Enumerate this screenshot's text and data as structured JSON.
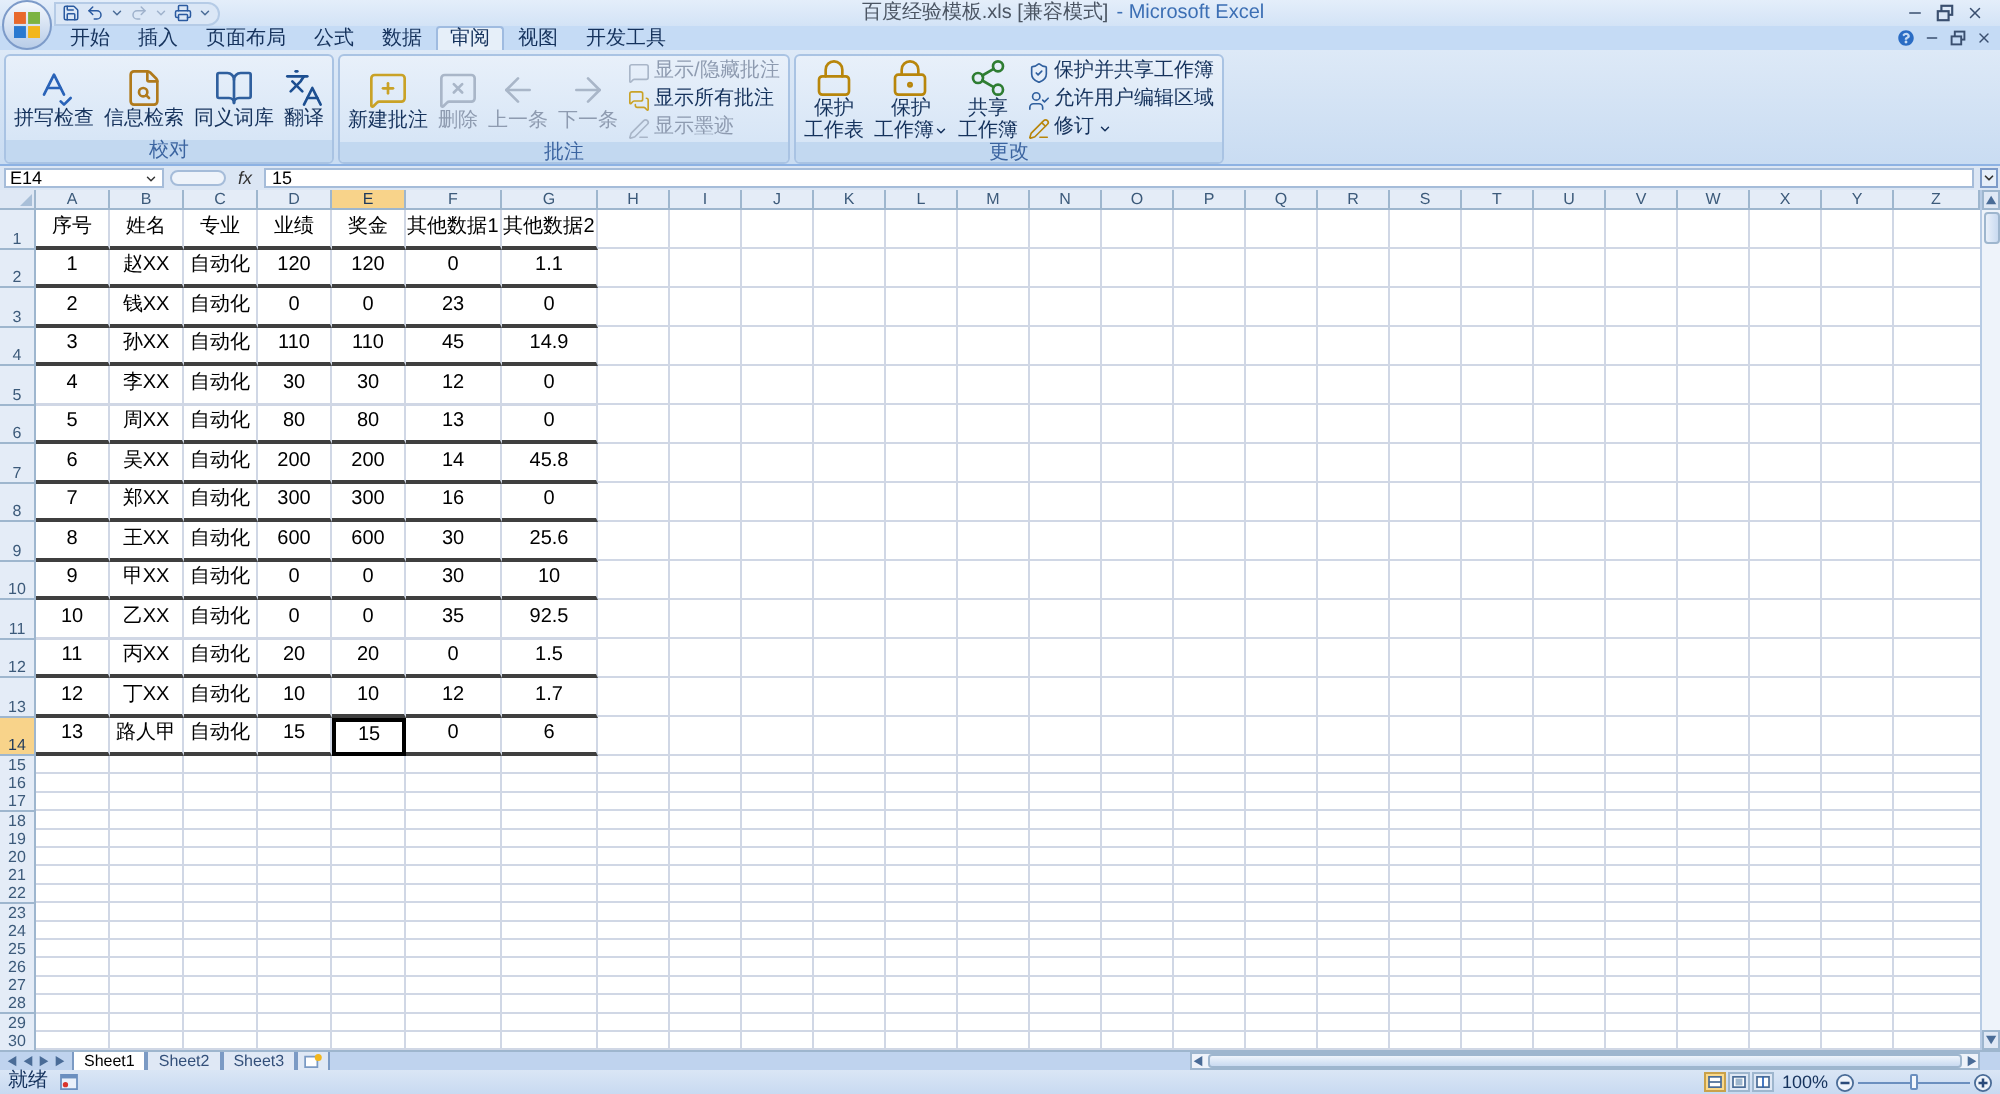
{
  "window": {
    "title": "百度经验模板.xls [兼容模式]",
    "application": "- Microsoft Excel"
  },
  "ribbon_tabs": [
    {
      "label": "开始",
      "selected": false
    },
    {
      "label": "插入",
      "selected": false
    },
    {
      "label": "页面布局",
      "selected": false
    },
    {
      "label": "公式",
      "selected": false
    },
    {
      "label": "数据",
      "selected": false
    },
    {
      "label": "审阅",
      "selected": true
    },
    {
      "label": "视图",
      "selected": false
    },
    {
      "label": "开发工具",
      "selected": false
    }
  ],
  "ribbon_groups": [
    {
      "label": "校对",
      "buttons": [
        {
          "kind": "large",
          "label_lines": [
            "拼写检查"
          ],
          "disabled": false,
          "dropdown": false
        },
        {
          "kind": "large",
          "label_lines": [
            "信息检索"
          ],
          "disabled": false,
          "dropdown": false
        },
        {
          "kind": "large",
          "label_lines": [
            "同义词库"
          ],
          "disabled": false,
          "dropdown": false
        },
        {
          "kind": "large",
          "label_lines": [
            "翻译"
          ],
          "disabled": false,
          "dropdown": false
        }
      ]
    },
    {
      "label": "批注",
      "buttons": [
        {
          "kind": "large",
          "label_lines": [
            "新建批注"
          ],
          "disabled": false,
          "dropdown": false
        },
        {
          "kind": "large",
          "label_lines": [
            "删除"
          ],
          "disabled": true,
          "dropdown": false
        },
        {
          "kind": "large",
          "label_lines": [
            "上一条"
          ],
          "disabled": true,
          "dropdown": false
        },
        {
          "kind": "large",
          "label_lines": [
            "下一条"
          ],
          "disabled": true,
          "dropdown": false
        },
        {
          "kind": "small",
          "label_lines": [
            "显示/隐藏批注"
          ],
          "disabled": true,
          "dropdown": false
        },
        {
          "kind": "small",
          "label_lines": [
            "显示所有批注"
          ],
          "disabled": false,
          "dropdown": false
        },
        {
          "kind": "small",
          "label_lines": [
            "显示墨迹"
          ],
          "disabled": true,
          "dropdown": false
        }
      ]
    },
    {
      "label": "更改",
      "buttons": [
        {
          "kind": "large",
          "label_lines": [
            "保护",
            "工作表"
          ],
          "disabled": false,
          "dropdown": false
        },
        {
          "kind": "large",
          "label_lines": [
            "保护",
            "工作簿"
          ],
          "disabled": false,
          "dropdown": true
        },
        {
          "kind": "large",
          "label_lines": [
            "共享",
            "工作簿"
          ],
          "disabled": false,
          "dropdown": false
        },
        {
          "kind": "small",
          "label_lines": [
            "保护并共享工作簿"
          ],
          "disabled": false,
          "dropdown": false
        },
        {
          "kind": "small",
          "label_lines": [
            "允许用户编辑区域"
          ],
          "disabled": false,
          "dropdown": false
        },
        {
          "kind": "small",
          "label_lines": [
            "修订"
          ],
          "disabled": false,
          "dropdown": true
        }
      ]
    }
  ],
  "formula_bar": {
    "name_box": "E14",
    "function_label": "fx",
    "formula": "15"
  },
  "sheet": {
    "columns": [
      {
        "label": "A",
        "selected": false
      },
      {
        "label": "B",
        "selected": false
      },
      {
        "label": "C",
        "selected": false
      },
      {
        "label": "D",
        "selected": false
      },
      {
        "label": "E",
        "selected": true
      },
      {
        "label": "F",
        "selected": false
      },
      {
        "label": "G",
        "selected": false
      },
      {
        "label": "H",
        "selected": false
      },
      {
        "label": "I",
        "selected": false
      },
      {
        "label": "J",
        "selected": false
      },
      {
        "label": "K",
        "selected": false
      },
      {
        "label": "L",
        "selected": false
      },
      {
        "label": "M",
        "selected": false
      },
      {
        "label": "N",
        "selected": false
      },
      {
        "label": "O",
        "selected": false
      },
      {
        "label": "P",
        "selected": false
      },
      {
        "label": "Q",
        "selected": false
      },
      {
        "label": "R",
        "selected": false
      },
      {
        "label": "S",
        "selected": false
      },
      {
        "label": "T",
        "selected": false
      },
      {
        "label": "U",
        "selected": false
      },
      {
        "label": "V",
        "selected": false
      },
      {
        "label": "W",
        "selected": false
      },
      {
        "label": "X",
        "selected": false
      },
      {
        "label": "Y",
        "selected": false
      },
      {
        "label": "Z",
        "selected": false
      }
    ],
    "rows": [
      {
        "number": "1",
        "selected": false,
        "bottom_border": true,
        "cells": [
          "序号",
          "姓名",
          "专业",
          "业绩",
          "奖金",
          "其他数据1",
          "其他数据2"
        ]
      },
      {
        "number": "2",
        "selected": false,
        "bottom_border": true,
        "cells": [
          "1",
          "赵XX",
          "自动化",
          "120",
          "120",
          "0",
          "1.1"
        ]
      },
      {
        "number": "3",
        "selected": false,
        "bottom_border": true,
        "cells": [
          "2",
          "钱XX",
          "自动化",
          "0",
          "0",
          "23",
          "0"
        ]
      },
      {
        "number": "4",
        "selected": false,
        "bottom_border": true,
        "cells": [
          "3",
          "孙XX",
          "自动化",
          "110",
          "110",
          "45",
          "14.9"
        ]
      },
      {
        "number": "5",
        "selected": false,
        "bottom_border": false,
        "cells": [
          "4",
          "李XX",
          "自动化",
          "30",
          "30",
          "12",
          "0"
        ]
      },
      {
        "number": "6",
        "selected": false,
        "bottom_border": true,
        "cells": [
          "5",
          "周XX",
          "自动化",
          "80",
          "80",
          "13",
          "0"
        ]
      },
      {
        "number": "7",
        "selected": false,
        "bottom_border": true,
        "cells": [
          "6",
          "吴XX",
          "自动化",
          "200",
          "200",
          "14",
          "45.8"
        ]
      },
      {
        "number": "8",
        "selected": false,
        "bottom_border": true,
        "cells": [
          "7",
          "郑XX",
          "自动化",
          "300",
          "300",
          "16",
          "0"
        ]
      },
      {
        "number": "9",
        "selected": false,
        "bottom_border": true,
        "cells": [
          "8",
          "王XX",
          "自动化",
          "600",
          "600",
          "30",
          "25.6"
        ]
      },
      {
        "number": "10",
        "selected": false,
        "bottom_border": true,
        "cells": [
          "9",
          "甲XX",
          "自动化",
          "0",
          "0",
          "30",
          "10"
        ]
      },
      {
        "number": "11",
        "selected": false,
        "bottom_border": false,
        "cells": [
          "10",
          "乙XX",
          "自动化",
          "0",
          "0",
          "35",
          "92.5"
        ]
      },
      {
        "number": "12",
        "selected": false,
        "bottom_border": true,
        "cells": [
          "11",
          "丙XX",
          "自动化",
          "20",
          "20",
          "0",
          "1.5"
        ]
      },
      {
        "number": "13",
        "selected": false,
        "bottom_border": true,
        "cells": [
          "12",
          "丁XX",
          "自动化",
          "10",
          "10",
          "12",
          "1.7"
        ]
      },
      {
        "number": "14",
        "selected": true,
        "bottom_border": true,
        "cells": [
          "13",
          "路人甲",
          "自动化",
          "15",
          "15",
          "0",
          "6"
        ]
      },
      {
        "number": "15",
        "selected": false
      },
      {
        "number": "16",
        "selected": false
      },
      {
        "number": "17",
        "selected": false
      },
      {
        "number": "18",
        "selected": false
      },
      {
        "number": "19",
        "selected": false
      },
      {
        "number": "20",
        "selected": false
      },
      {
        "number": "21",
        "selected": false
      },
      {
        "number": "22",
        "selected": false
      },
      {
        "number": "23",
        "selected": false
      },
      {
        "number": "24",
        "selected": false
      },
      {
        "number": "25",
        "selected": false
      },
      {
        "number": "26",
        "selected": false
      },
      {
        "number": "27",
        "selected": false
      },
      {
        "number": "28",
        "selected": false
      },
      {
        "number": "29",
        "selected": false
      },
      {
        "number": "30",
        "selected": false
      }
    ]
  },
  "sheet_tabs": [
    {
      "label": "Sheet1",
      "selected": true
    },
    {
      "label": "Sheet2",
      "selected": false
    },
    {
      "label": "Sheet3",
      "selected": false
    }
  ],
  "status_bar": {
    "status": "就绪",
    "view_buttons": [
      {
        "selected": true
      },
      {
        "selected": false
      },
      {
        "selected": false
      }
    ],
    "zoom": "100%",
    "zoom_slider": {
      "level": 0.5
    }
  }
}
